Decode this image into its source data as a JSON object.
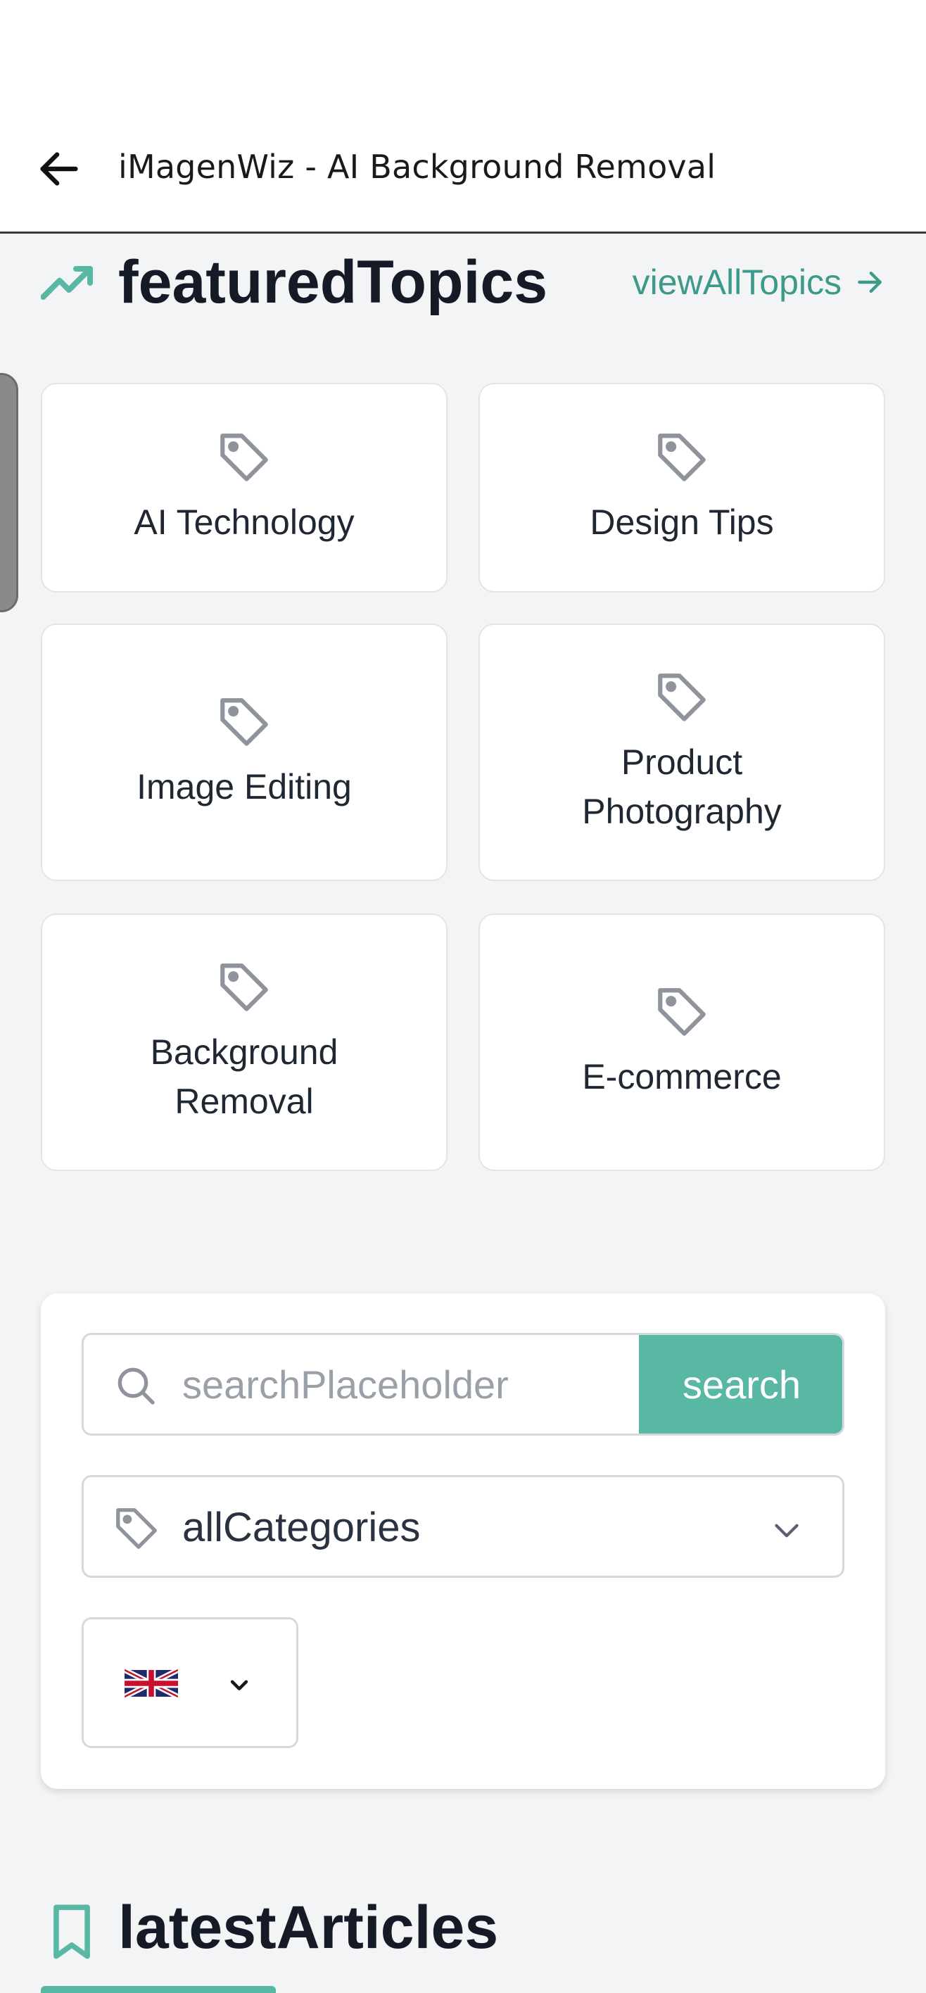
{
  "appbar": {
    "title": "iMagenWiz - AI Background Removal"
  },
  "featured": {
    "title": "featuredTopics",
    "view_all_label": "viewAllTopics",
    "topics": [
      {
        "label": "AI Technology"
      },
      {
        "label": "Design Tips"
      },
      {
        "label": "Image Editing"
      },
      {
        "label": "Product Photography"
      },
      {
        "label": "Background Removal"
      },
      {
        "label": "E-commerce"
      }
    ]
  },
  "search": {
    "placeholder": "searchPlaceholder",
    "value": "",
    "button_label": "search"
  },
  "category": {
    "selected": "allCategories"
  },
  "language": {
    "selected_flag": "uk-flag-icon"
  },
  "latest": {
    "title": "latestArticles"
  },
  "colors": {
    "accent": "#58b8a4",
    "accent_text": "#3d9a8a",
    "background": "#f2f4f5",
    "heading": "#141a26"
  }
}
